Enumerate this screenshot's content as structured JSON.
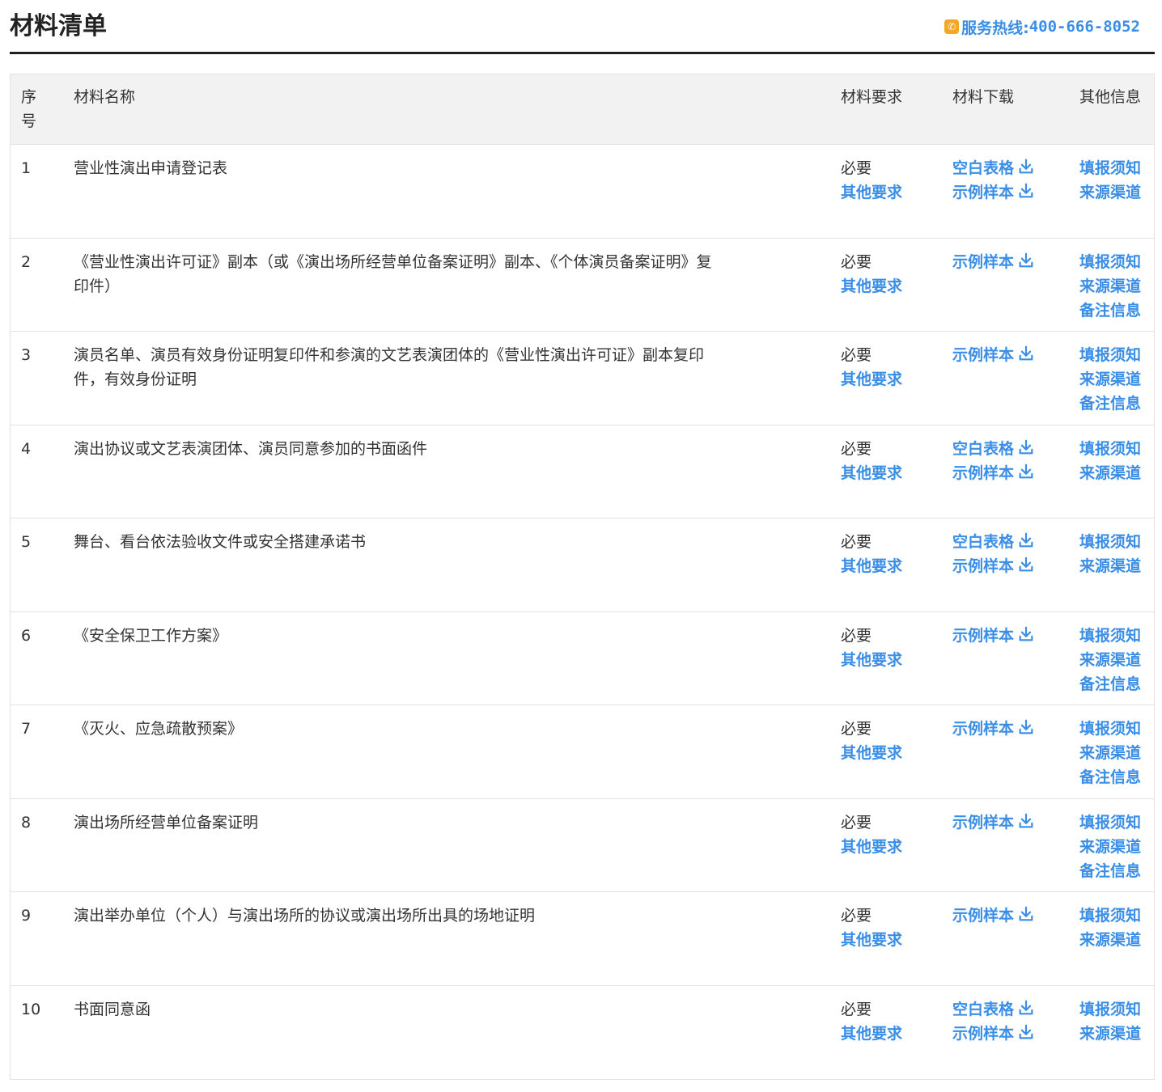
{
  "header": {
    "title": "材料清单",
    "hotline_label": "服务热线:",
    "hotline_number": "400-666-8052",
    "phone_icon": "phone-icon"
  },
  "table": {
    "columns": {
      "index": "序号",
      "name": "材料名称",
      "requirement": "材料要求",
      "download": "材料下载",
      "other": "其他信息"
    },
    "rows": [
      {
        "index": "1",
        "name": "营业性演出申请登记表",
        "requirement": "必要",
        "requirement_link": "其他要求",
        "downloads": [
          "空白表格",
          "示例样本"
        ],
        "others": [
          "填报须知",
          "来源渠道"
        ]
      },
      {
        "index": "2",
        "name": "《营业性演出许可证》副本（或《演出场所经营单位备案证明》副本、《个体演员备案证明》复印件）",
        "requirement": "必要",
        "requirement_link": "其他要求",
        "downloads": [
          "示例样本"
        ],
        "others": [
          "填报须知",
          "来源渠道",
          "备注信息"
        ]
      },
      {
        "index": "3",
        "name": "演员名单、演员有效身份证明复印件和参演的文艺表演团体的《营业性演出许可证》副本复印件，有效身份证明",
        "requirement": "必要",
        "requirement_link": "其他要求",
        "downloads": [
          "示例样本"
        ],
        "others": [
          "填报须知",
          "来源渠道",
          "备注信息"
        ]
      },
      {
        "index": "4",
        "name": "演出协议或文艺表演团体、演员同意参加的书面函件",
        "requirement": "必要",
        "requirement_link": "其他要求",
        "downloads": [
          "空白表格",
          "示例样本"
        ],
        "others": [
          "填报须知",
          "来源渠道"
        ]
      },
      {
        "index": "5",
        "name": "舞台、看台依法验收文件或安全搭建承诺书",
        "requirement": "必要",
        "requirement_link": "其他要求",
        "downloads": [
          "空白表格",
          "示例样本"
        ],
        "others": [
          "填报须知",
          "来源渠道"
        ]
      },
      {
        "index": "6",
        "name": "《安全保卫工作方案》",
        "requirement": "必要",
        "requirement_link": "其他要求",
        "downloads": [
          "示例样本"
        ],
        "others": [
          "填报须知",
          "来源渠道",
          "备注信息"
        ]
      },
      {
        "index": "7",
        "name": "《灭火、应急疏散预案》",
        "requirement": "必要",
        "requirement_link": "其他要求",
        "downloads": [
          "示例样本"
        ],
        "others": [
          "填报须知",
          "来源渠道",
          "备注信息"
        ]
      },
      {
        "index": "8",
        "name": "演出场所经营单位备案证明",
        "requirement": "必要",
        "requirement_link": "其他要求",
        "downloads": [
          "示例样本"
        ],
        "others": [
          "填报须知",
          "来源渠道",
          "备注信息"
        ]
      },
      {
        "index": "9",
        "name": "演出举办单位（个人）与演出场所的协议或演出场所出具的场地证明",
        "requirement": "必要",
        "requirement_link": "其他要求",
        "downloads": [
          "示例样本"
        ],
        "others": [
          "填报须知",
          "来源渠道"
        ]
      },
      {
        "index": "10",
        "name": "书面同意函",
        "requirement": "必要",
        "requirement_link": "其他要求",
        "downloads": [
          "空白表格",
          "示例样本"
        ],
        "others": [
          "填报须知",
          "来源渠道"
        ]
      }
    ]
  },
  "colors": {
    "link": "#3a8ee6",
    "header_bg": "#f2f2f2",
    "border": "#e3e3e3",
    "phone_icon": "#f5a623"
  }
}
